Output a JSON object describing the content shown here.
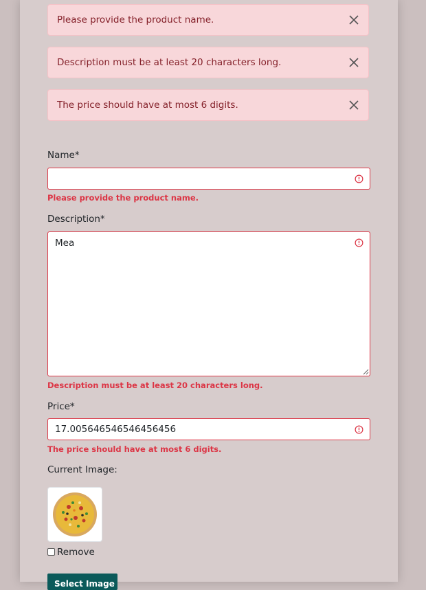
{
  "alerts": [
    {
      "message": "Please provide the product name."
    },
    {
      "message": "Description must be at least 20 characters long."
    },
    {
      "message": "The price should have at most 6 digits."
    }
  ],
  "form": {
    "name": {
      "label": "Name*",
      "value": "",
      "error": "Please provide the product name."
    },
    "description": {
      "label": "Description*",
      "value": "Mea",
      "error": "Description must be at least 20 characters long."
    },
    "price": {
      "label": "Price*",
      "value": "17.005646546546456456",
      "error": "The price should have at most 6 digits."
    },
    "current_image": {
      "label": "Current Image:",
      "image_icon": "pizza-image",
      "remove_label": "Remove",
      "remove_checked": false
    },
    "select_image_button": "Select Image"
  },
  "colors": {
    "page_bg": "#cbbfbf",
    "card_bg": "#d7cccc",
    "alert_bg": "#f8d7da",
    "alert_text": "#842029",
    "error": "#dc3545",
    "button_bg": "#0b5a5a"
  }
}
